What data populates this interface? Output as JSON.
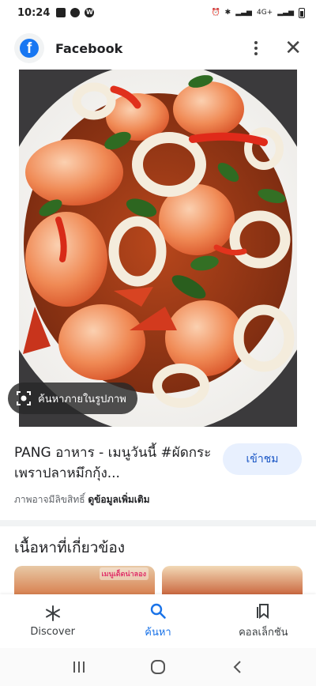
{
  "status_bar": {
    "time": "10:24",
    "network": "4G+"
  },
  "header": {
    "site_name": "Facebook",
    "logo_letter": "f"
  },
  "image": {
    "lens_label": "ค้นหาภายในรูปภาพ"
  },
  "result": {
    "title": "PANG อาหาร - เมนูวันนี้ #ผัดกระเพราปลาหมึกกุ้ง...",
    "visit_label": "เข้าชม",
    "copyright_text": "ภาพอาจมีลิขสิทธิ์",
    "more_info_link": "ดูข้อมูลเพิ่มเติม"
  },
  "related": {
    "heading": "เนื้อหาที่เกี่ยวข้อง",
    "thumb1_badge": "เมนูเด็ดน่าลอง"
  },
  "bottom_nav": {
    "items": [
      {
        "label": "Discover",
        "icon": "asterisk-icon"
      },
      {
        "label": "ค้นหา",
        "icon": "search-icon"
      },
      {
        "label": "คอลเล็กชัน",
        "icon": "collections-icon"
      }
    ],
    "active_index": 1
  },
  "colors": {
    "accent": "#1a73e8",
    "facebook_blue": "#1877f2",
    "visit_button_bg": "#e8f0fe"
  }
}
